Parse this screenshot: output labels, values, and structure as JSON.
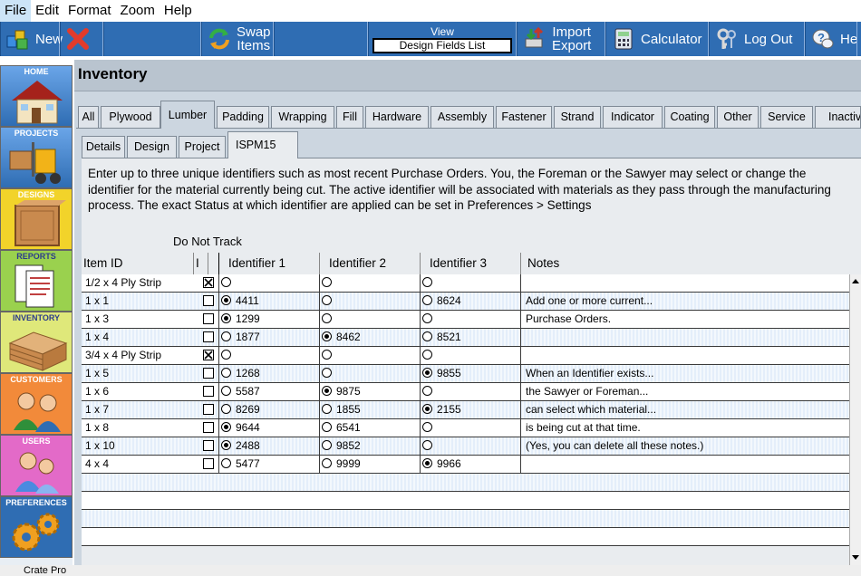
{
  "menu": [
    "File",
    "Edit",
    "Format",
    "Zoom",
    "Help"
  ],
  "toolbar": {
    "new_label": "New",
    "swap_label1": "Swap",
    "swap_label2": "Items",
    "view_label": "View",
    "view_value": "Design Fields List",
    "import_label1": "Import",
    "import_label2": "Export",
    "calculator_label": "Calculator",
    "logout_label": "Log Out",
    "help_label": "He"
  },
  "nav": {
    "home": "HOME",
    "projects": "PROJECTS",
    "designs": "DESIGNS",
    "reports": "REPORTS",
    "inventory": "INVENTORY",
    "customers": "CUSTOMERS",
    "users": "USERS",
    "preferences": "PREFERENCES"
  },
  "title": "Inventory",
  "tabs": [
    "All",
    "Plywood",
    "Lumber",
    "Padding",
    "Wrapping",
    "Fill",
    "Hardware",
    "Assembly",
    "Fastener",
    "Strand",
    "Indicator",
    "Coating",
    "Other",
    "Service",
    "Inactive"
  ],
  "subtabs": [
    "Details",
    "Design",
    "Project",
    "ISPM15"
  ],
  "instructions": "Enter up to three unique identifiers such as most recent Purchase Orders. You, the Foreman or the Sawyer may select or change the identifier for the material currently being cut. The active identifier will be associated with materials as they pass through the manufacturing process. The exact Status at which identifier are applied can be set in Preferences > Settings",
  "do_not_track_label": "Do Not Track",
  "columns": {
    "item": "Item ID",
    "dnt": "I",
    "id1": "Identifier 1",
    "id2": "Identifier 2",
    "id3": "Identifier 3",
    "notes": "Notes"
  },
  "rows": [
    {
      "item": "1/2 x 4 Ply Strip",
      "dnt": true,
      "id1": "",
      "id2": "",
      "id3": "",
      "sel": 0,
      "notes": ""
    },
    {
      "item": "1 x 1",
      "dnt": false,
      "id1": "4411",
      "id2": "",
      "id3": "8624",
      "sel": 1,
      "notes": "Add one or more current..."
    },
    {
      "item": "1 x 3",
      "dnt": false,
      "id1": "1299",
      "id2": "",
      "id3": "",
      "sel": 1,
      "notes": "Purchase Orders."
    },
    {
      "item": "1 x 4",
      "dnt": false,
      "id1": "1877",
      "id2": "8462",
      "id3": "8521",
      "sel": 2,
      "notes": ""
    },
    {
      "item": "3/4 x 4 Ply Strip",
      "dnt": true,
      "id1": "",
      "id2": "",
      "id3": "",
      "sel": 0,
      "notes": ""
    },
    {
      "item": "1 x 5",
      "dnt": false,
      "id1": "1268",
      "id2": "",
      "id3": "9855",
      "sel": 3,
      "notes": "When an Identifier exists..."
    },
    {
      "item": "1 x 6",
      "dnt": false,
      "id1": "5587",
      "id2": "9875",
      "id3": "",
      "sel": 2,
      "notes": "the Sawyer or Foreman..."
    },
    {
      "item": "1 x 7",
      "dnt": false,
      "id1": "8269",
      "id2": "1855",
      "id3": "2155",
      "sel": 3,
      "notes": "can select which material..."
    },
    {
      "item": "1 x 8",
      "dnt": false,
      "id1": "9644",
      "id2": "6541",
      "id3": "",
      "sel": 1,
      "notes": "is being cut at that time."
    },
    {
      "item": "1 x 10",
      "dnt": false,
      "id1": "2488",
      "id2": "9852",
      "id3": "",
      "sel": 1,
      "notes": "(Yes, you can delete all these notes.)"
    },
    {
      "item": "4 x 4",
      "dnt": false,
      "id1": "5477",
      "id2": "9999",
      "id3": "9966",
      "sel": 3,
      "notes": ""
    }
  ],
  "status_text": "Crate Pro"
}
